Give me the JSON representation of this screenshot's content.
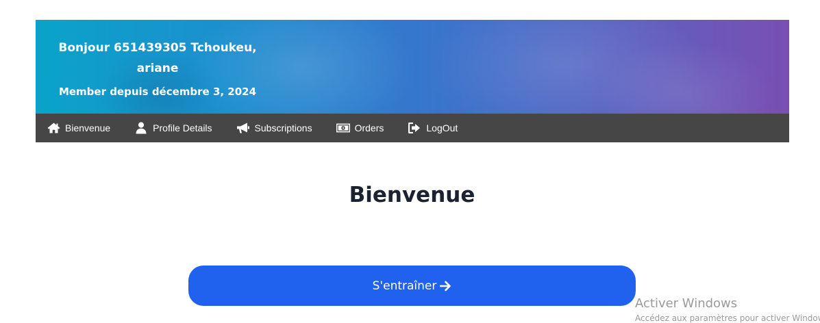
{
  "hero": {
    "greeting_line1": "Bonjour 651439305 Tchoukeu,",
    "greeting_line2": "ariane",
    "member_since": "Member depuis décembre 3, 2024"
  },
  "nav": {
    "items": [
      {
        "label": "Bienvenue",
        "icon": "home-icon"
      },
      {
        "label": "Profile Details",
        "icon": "user-icon"
      },
      {
        "label": "Subscriptions",
        "icon": "megaphone-icon"
      },
      {
        "label": "Orders",
        "icon": "money-icon"
      },
      {
        "label": "LogOut",
        "icon": "sign-out-icon"
      }
    ]
  },
  "main": {
    "title": "Bienvenue",
    "cta_label": "S'entraîner"
  },
  "os_watermark": {
    "title": "Activer Windows",
    "subtitle": "Accédez aux paramètres pour activer Windows."
  },
  "colors": {
    "navbar_bg": "#464646",
    "cta_bg": "#2062ee",
    "title_text": "#1b2331",
    "hero_gradient_start": "#0aa3c9",
    "hero_gradient_end": "#7a4fb3"
  }
}
